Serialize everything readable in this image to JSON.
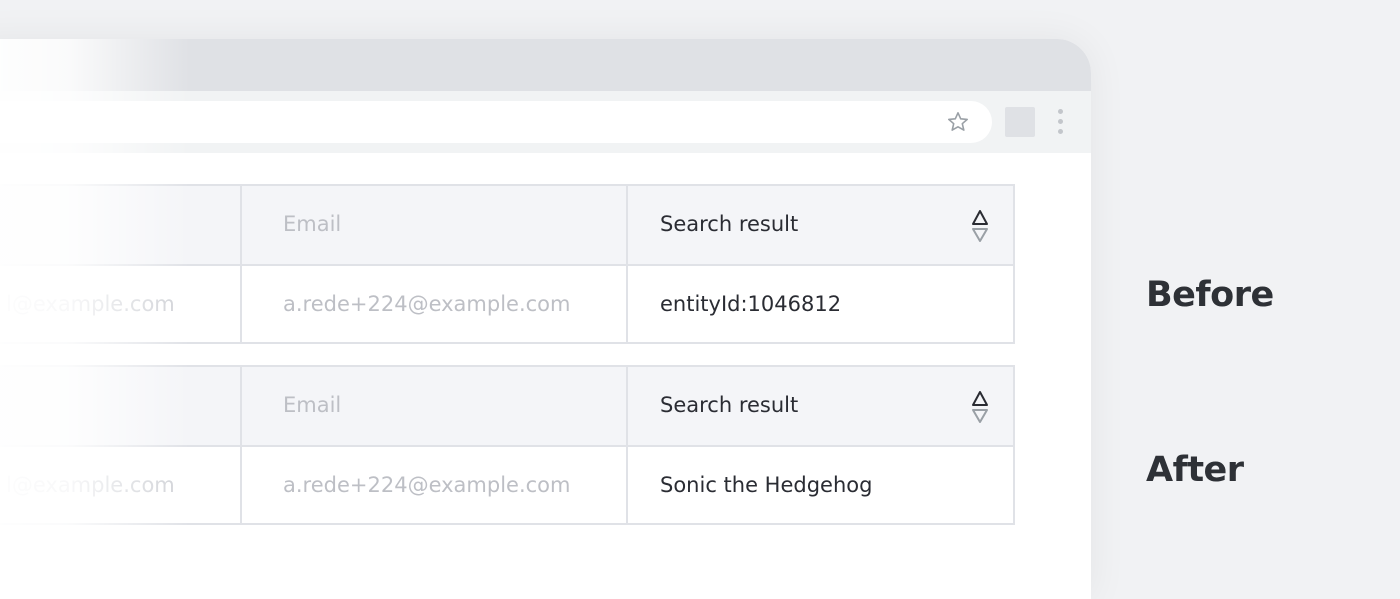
{
  "browser": {
    "toolbar_icons": [
      "star-icon",
      "extension-icon",
      "kebab-menu-icon"
    ]
  },
  "tables": [
    {
      "id": "before",
      "headers": {
        "email": "Email",
        "search_result": "Search result"
      },
      "row": {
        "left_partial": "l@example.com",
        "email": "a.rede+224@example.com",
        "search_result": "entityId:1046812"
      }
    },
    {
      "id": "after",
      "headers": {
        "email": "Email",
        "search_result": "Search result"
      },
      "row": {
        "left_partial": "l@example.com",
        "email": "a.rede+224@example.com",
        "search_result": "Sonic the Hedgehog"
      }
    }
  ],
  "labels": {
    "before": "Before",
    "after": "After"
  },
  "colors": {
    "page_bg": "#f1f2f4",
    "header_bg": "#f4f5f8",
    "border": "#e0e2e7",
    "text_dark": "#2a2c33",
    "text_muted": "#bdbfc5"
  }
}
